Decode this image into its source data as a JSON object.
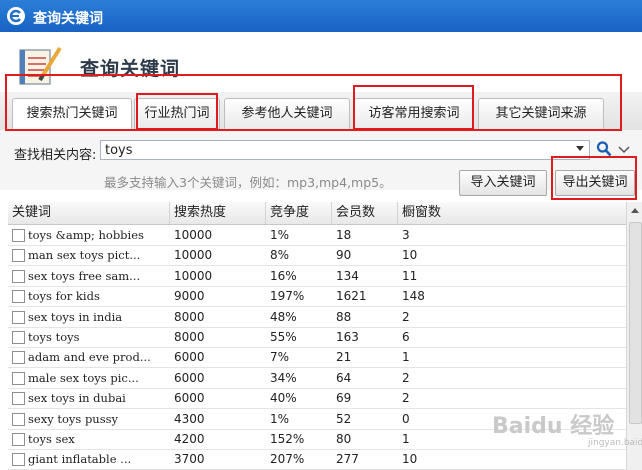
{
  "window": {
    "title": "查询关键词",
    "logo_icon": "app-logo-icon"
  },
  "header": {
    "title": "查询关键词",
    "icon": "notebook-pen-icon"
  },
  "tabs": [
    {
      "label": "搜索热门关键词",
      "active": true
    },
    {
      "label": "行业热门词",
      "active": false
    },
    {
      "label": "参考他人关键词",
      "active": false
    },
    {
      "label": "访客常用搜索词",
      "active": false
    },
    {
      "label": "其它关键词来源",
      "active": false
    }
  ],
  "search": {
    "label": "查找相关内容:",
    "value": "toys",
    "hint": "最多支持输入3个关键词，例如：mp3,mp4,mp5。"
  },
  "buttons": {
    "import": "导入关键词",
    "export": "导出关键词"
  },
  "table": {
    "columns": [
      "关键词",
      "搜索热度",
      "竞争度",
      "会员数",
      "橱窗数"
    ],
    "rows": [
      [
        "toys &amp; hobbies",
        "10000",
        "1%",
        "18",
        "3"
      ],
      [
        "man sex toys pict...",
        "10000",
        "8%",
        "90",
        "10"
      ],
      [
        "sex toys free sam...",
        "10000",
        "16%",
        "134",
        "11"
      ],
      [
        "toys for kids",
        "9000",
        "197%",
        "1621",
        "148"
      ],
      [
        "sex toys in india",
        "8000",
        "48%",
        "88",
        "2"
      ],
      [
        "toys toys",
        "8000",
        "55%",
        "163",
        "6"
      ],
      [
        "adam and eve prod...",
        "6000",
        "7%",
        "21",
        "1"
      ],
      [
        "male sex toys pic...",
        "6000",
        "34%",
        "64",
        "2"
      ],
      [
        "sex toys in dubai",
        "6000",
        "40%",
        "69",
        "2"
      ],
      [
        "sexy toys pussy",
        "4300",
        "1%",
        "52",
        "0"
      ],
      [
        "toys sex",
        "4200",
        "152%",
        "80",
        "1"
      ],
      [
        "giant inflatable ...",
        "3700",
        "207%",
        "277",
        "10"
      ]
    ]
  },
  "watermark": {
    "text": "Baidu 经验",
    "sub": "jingyan.baidu.com"
  },
  "colors": {
    "titlebar": "#1f6fd0",
    "annotation": "#e01b1b"
  }
}
